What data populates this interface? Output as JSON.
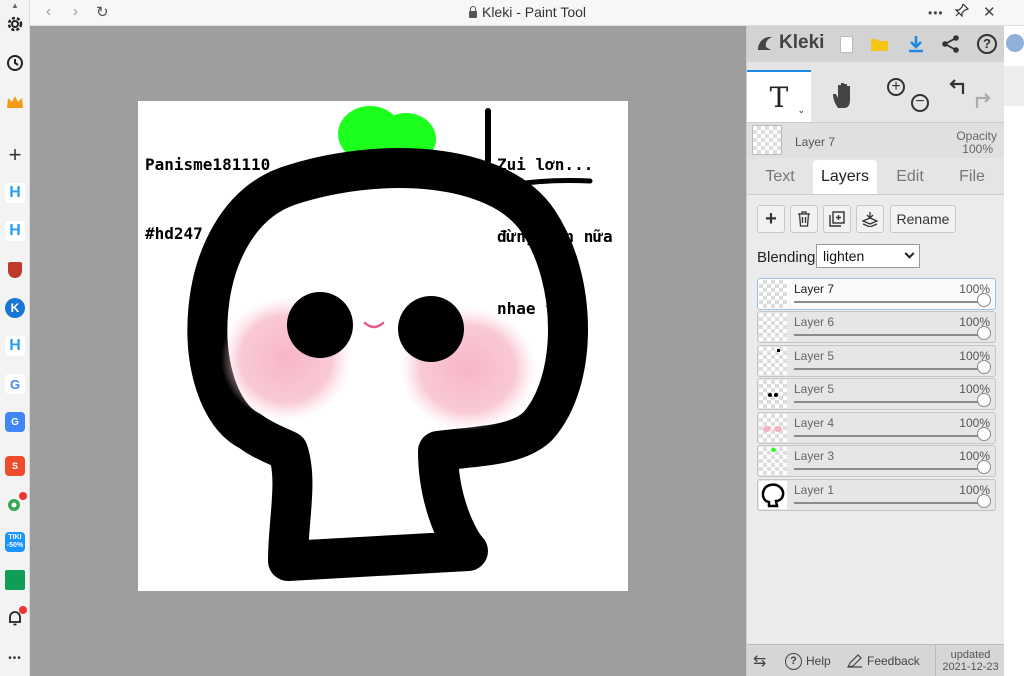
{
  "window": {
    "title": "Kleki - Paint Tool"
  },
  "sidebar": {
    "icons": [
      "settings-icon",
      "history-icon",
      "crown-icon",
      "add-icon",
      "h-app-icon",
      "h-app-icon",
      "shield-app-icon",
      "kleki-app-icon",
      "h-app-icon",
      "google-icon",
      "translate-icon",
      "shopee-icon",
      "maps-icon",
      "tiki-icon",
      "sheets-icon",
      "bell-icon",
      "more-icon"
    ],
    "tiki_badge": "-50%",
    "more_label": "•••"
  },
  "canvas": {
    "text_top_left": [
      "Panisme181110",
      "#hd247"
    ],
    "text_top_right": [
      "Zui lơn...",
      "đừng pùn nữa",
      "nhae ^^"
    ]
  },
  "panel": {
    "brand": "Kleki",
    "current_layer": {
      "name": "Layer 7",
      "opacity_label": "Opacity",
      "opacity_value": "100%"
    },
    "tabs": [
      {
        "label": "Text"
      },
      {
        "label": "Layers"
      },
      {
        "label": "Edit"
      },
      {
        "label": "File"
      }
    ],
    "rename_label": "Rename",
    "blending": {
      "label": "Blending",
      "value": "lighten"
    },
    "layers": [
      {
        "name": "Layer 7",
        "opacity": "100%"
      },
      {
        "name": "Layer 6",
        "opacity": "100%"
      },
      {
        "name": "Layer 5",
        "opacity": "100%"
      },
      {
        "name": "Layer 5",
        "opacity": "100%"
      },
      {
        "name": "Layer 4",
        "opacity": "100%"
      },
      {
        "name": "Layer 3",
        "opacity": "100%"
      },
      {
        "name": "Layer 1",
        "opacity": "100%"
      }
    ],
    "bottom": {
      "help": "Help",
      "feedback": "Feedback",
      "updated_label": "updated",
      "updated_date": "2021-12-23"
    }
  },
  "colors": {
    "accent": "#1e88e5",
    "leaf": "#1dff1d",
    "blush": "#f7b7c6",
    "workspace": "#9e9e9e"
  }
}
